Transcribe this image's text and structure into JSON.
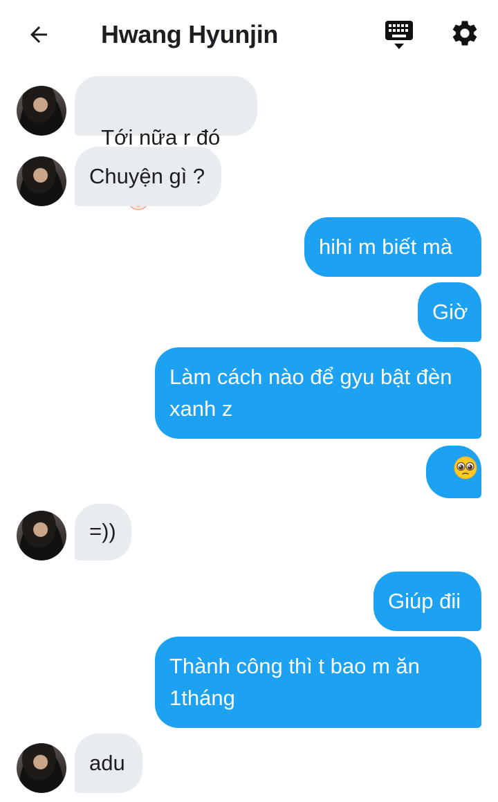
{
  "header": {
    "title": "Hwang Hyunjin",
    "back_icon": "arrow-left-icon",
    "keyboard_icon": "keyboard-icon",
    "settings_icon": "gear-icon"
  },
  "messages": [
    {
      "from": "them",
      "text": "Tới nữa r đó",
      "emoji": "clown-face-emoji"
    },
    {
      "from": "them",
      "text": "Chuyện gì ?"
    },
    {
      "from": "me",
      "text": "hihi m biết mà"
    },
    {
      "from": "me",
      "text": "Giờ"
    },
    {
      "from": "me",
      "text": "Làm cách nào để gyu bật đèn xanh z"
    },
    {
      "from": "me",
      "text": "",
      "emoji": "pleading-face-emoji"
    },
    {
      "from": "them",
      "text": "=))"
    },
    {
      "from": "me",
      "text": "Giúp đii"
    },
    {
      "from": "me",
      "text": "Thành công thì t bao m ăn 1tháng"
    },
    {
      "from": "them",
      "text": "adu"
    }
  ],
  "colors": {
    "outgoing_bubble": "#1da1f2",
    "incoming_bubble": "#e8ebef",
    "text": "#1c1e21"
  }
}
